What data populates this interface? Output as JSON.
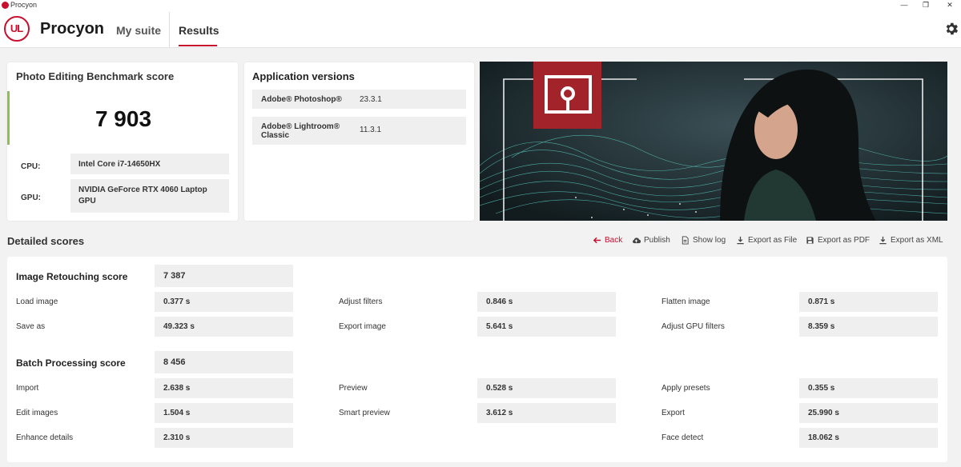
{
  "window": {
    "title": "Procyon",
    "controls": [
      "—",
      "❐",
      "✕"
    ]
  },
  "nav": {
    "logo_text": "UL",
    "brand": "Procyon",
    "tabs": [
      {
        "label": "My suite"
      },
      {
        "label": "Results"
      }
    ],
    "active_tab": "Results",
    "settings_icon": "gear-icon"
  },
  "score_card": {
    "title": "Photo Editing Benchmark score",
    "score": "7 903",
    "cpu_label": "CPU:",
    "cpu_value": "Intel Core i7-14650HX",
    "gpu_label": "GPU:",
    "gpu_value": "NVIDIA GeForce RTX 4060 Laptop GPU",
    "accent_color": "#8bc34a"
  },
  "versions": {
    "title": "Application versions",
    "rows": [
      {
        "name": "Adobe® Photoshop®",
        "version": "23.3.1"
      },
      {
        "name": "Adobe® Lightroom® Classic",
        "version": "11.3.1"
      }
    ]
  },
  "detailed": {
    "title": "Detailed scores",
    "actions": [
      {
        "label": "Back",
        "icon": "arrow-left-icon"
      },
      {
        "label": "Publish",
        "icon": "cloud-upload-icon"
      },
      {
        "label": "Show log",
        "icon": "document-icon"
      },
      {
        "label": "Export as File",
        "icon": "download-icon"
      },
      {
        "label": "Export as PDF",
        "icon": "save-icon"
      },
      {
        "label": "Export as XML",
        "icon": "download-icon"
      }
    ],
    "groups": [
      {
        "label": "Image Retouching score",
        "score": "7 387",
        "rows": [
          [
            {
              "label": "Load image",
              "value": "0.377 s"
            },
            {
              "label": "Adjust filters",
              "value": "0.846 s"
            },
            {
              "label": "Flatten image",
              "value": "0.871 s"
            }
          ],
          [
            {
              "label": "Save as",
              "value": "49.323 s"
            },
            {
              "label": "Export image",
              "value": "5.641 s"
            },
            {
              "label": "Adjust GPU filters",
              "value": "8.359 s"
            }
          ]
        ]
      },
      {
        "label": "Batch Processing score",
        "score": "8 456",
        "rows": [
          [
            {
              "label": "Import",
              "value": "2.638 s"
            },
            {
              "label": "Preview",
              "value": "0.528 s"
            },
            {
              "label": "Apply presets",
              "value": "0.355 s"
            }
          ],
          [
            {
              "label": "Edit images",
              "value": "1.504 s"
            },
            {
              "label": "Smart preview",
              "value": "3.612 s"
            },
            {
              "label": "Export",
              "value": "25.990 s"
            }
          ],
          [
            {
              "label": "Enhance details",
              "value": "2.310 s"
            },
            {
              "label": "",
              "value": ""
            },
            {
              "label": "Face detect",
              "value": "18.062 s"
            }
          ]
        ]
      }
    ]
  },
  "colors": {
    "brand_red": "#c8102e",
    "panel_bg": "#efefef",
    "page_bg": "#f2f2f2"
  }
}
